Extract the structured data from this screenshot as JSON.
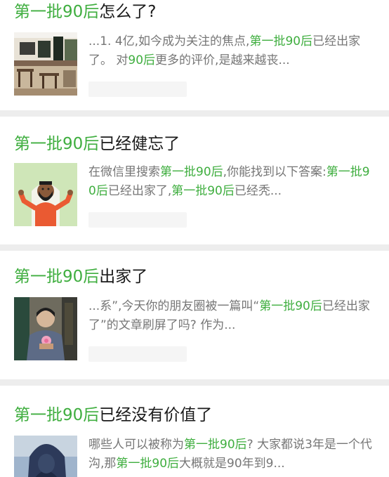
{
  "results": [
    {
      "title": [
        {
          "text": "第一批90后",
          "hl": true
        },
        {
          "text": "怎么了?",
          "hl": false
        }
      ],
      "snippet": [
        {
          "text": "...1. 4亿,如今成为关注的焦点,",
          "hl": false
        },
        {
          "text": "第一批90后",
          "hl": true
        },
        {
          "text": "已经出家了。 对",
          "hl": false
        },
        {
          "text": "90后",
          "hl": true
        },
        {
          "text": "更多的评价,是越来越丧...",
          "hl": false
        }
      ],
      "thumb_icon": "cafe-interior-image"
    },
    {
      "title": [
        {
          "text": "第一批90后",
          "hl": true
        },
        {
          "text": "已经健忘了",
          "hl": false
        }
      ],
      "snippet": [
        {
          "text": "在微信里搜索",
          "hl": false
        },
        {
          "text": "第一批90后",
          "hl": true
        },
        {
          "text": ",你能找到以下答案:",
          "hl": false
        },
        {
          "text": "第一批90后",
          "hl": true
        },
        {
          "text": "已经出家了,",
          "hl": false
        },
        {
          "text": "第一批90后",
          "hl": true
        },
        {
          "text": "已经秃...",
          "hl": false
        }
      ],
      "thumb_icon": "shrug-person-illustration"
    },
    {
      "title": [
        {
          "text": "第一批90后",
          "hl": true
        },
        {
          "text": "出家了",
          "hl": false
        }
      ],
      "snippet": [
        {
          "text": "...系”,今天你的朋友圈被一篇叫“",
          "hl": false
        },
        {
          "text": "第一批90后",
          "hl": true
        },
        {
          "text": "已经出家了”的文章刷屏了吗? 作为...",
          "hl": false
        }
      ],
      "thumb_icon": "monk-with-lotus-photo"
    },
    {
      "title": [
        {
          "text": "第一批90后",
          "hl": true
        },
        {
          "text": "已经没有价值了",
          "hl": false
        }
      ],
      "snippet": [
        {
          "text": "哪些人可以被称为",
          "hl": false
        },
        {
          "text": "第一批90后",
          "hl": true
        },
        {
          "text": "? 大家都说3年是一个代沟,那",
          "hl": false
        },
        {
          "text": "第一批90后",
          "hl": true
        },
        {
          "text": "大概就是90年到9...",
          "hl": false
        }
      ],
      "thumb_icon": "hooded-figure-photo"
    }
  ],
  "colors": {
    "highlight": "#3fae3f",
    "title": "#1a1a1a",
    "snippet": "#767676",
    "separator": "#ededed"
  }
}
